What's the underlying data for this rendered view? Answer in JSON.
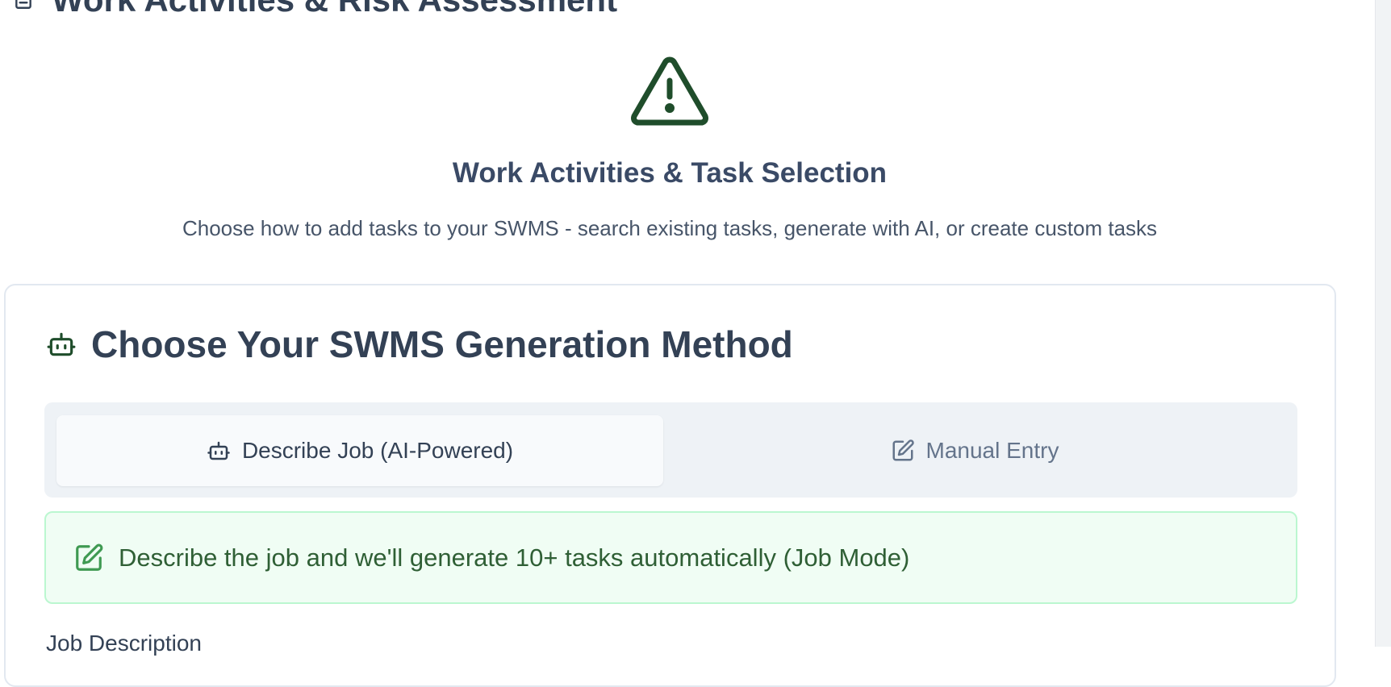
{
  "section": {
    "title": "Work Activities & Risk Assessment",
    "icon": "clipboard-icon"
  },
  "hero": {
    "icon": "warning-triangle-icon",
    "title": "Work Activities & Task Selection",
    "subtitle": "Choose how to add tasks to your SWMS - search existing tasks, generate with AI, or create custom tasks"
  },
  "method_card": {
    "title": "Choose Your SWMS Generation Method",
    "title_icon": "robot-icon",
    "tabs": [
      {
        "label": "Describe Job (AI-Powered)",
        "icon": "robot-icon",
        "active": true
      },
      {
        "label": "Manual Entry",
        "icon": "edit-icon",
        "active": false
      }
    ],
    "banner": {
      "icon": "edit-icon",
      "text": "Describe the job and we'll generate 10+ tasks automatically (Job Mode)"
    },
    "field_label": "Job Description"
  },
  "colors": {
    "accent_green": "#1f4d2b",
    "banner_bg": "#f0fdf4",
    "banner_border": "#bbf7d0",
    "banner_text": "#2f5f35",
    "heading": "#334155",
    "muted": "#64748b"
  }
}
